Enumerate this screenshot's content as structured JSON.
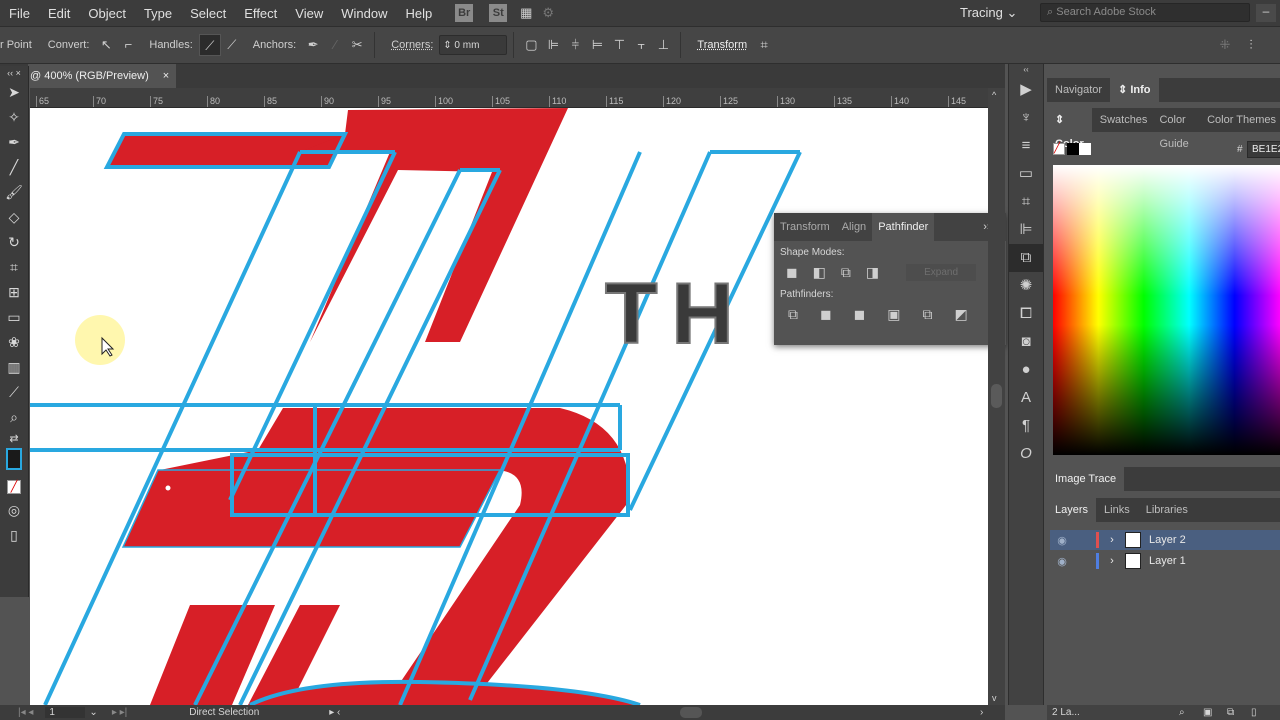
{
  "menu": [
    "File",
    "Edit",
    "Object",
    "Type",
    "Select",
    "Effect",
    "View",
    "Window",
    "Help"
  ],
  "menu_badges": {
    "bridge": "Br",
    "stock": "St"
  },
  "workspace": "Tracing",
  "search_placeholder": "Search Adobe Stock",
  "control": {
    "tool_label": "r Point",
    "convert": "Convert:",
    "handles": "Handles:",
    "anchors": "Anchors:",
    "corners": "Corners:",
    "corners_value": "0 mm",
    "transform": "Transform"
  },
  "document_tab": {
    "title": "@ 400% (RGB/Preview)",
    "close": "×"
  },
  "ruler_ticks": [
    "65",
    "70",
    "75",
    "80",
    "85",
    "90",
    "95",
    "100",
    "105",
    "110",
    "115",
    "120",
    "125",
    "130",
    "135",
    "140",
    "145"
  ],
  "artwork": {
    "text": "TH",
    "red": "#d71f27",
    "blue": "#29a8e0"
  },
  "pathfinder": {
    "tabs": [
      "Transform",
      "Align",
      "Pathfinder"
    ],
    "active": "Pathfinder",
    "shape_modes": "Shape Modes:",
    "pathfinders": "Pathfinders:",
    "expand": "Expand"
  },
  "panels": {
    "top_tabs": [
      "Navigator",
      "Info"
    ],
    "color_tabs": [
      "Color",
      "Swatches",
      "Color Guide",
      "Color Themes"
    ],
    "hex_prefix": "#",
    "hex_value": "BE1E2",
    "image_trace": "Image Trace",
    "layer_tabs": [
      "Layers",
      "Links",
      "Libraries"
    ],
    "layers": [
      {
        "name": "Layer 2",
        "color": "#e05050",
        "selected": true
      },
      {
        "name": "Layer 1",
        "color": "#4f7ee0",
        "selected": false
      }
    ],
    "layer_count": "2 La..."
  },
  "status": {
    "artboard": "1",
    "tool": "Direct Selection"
  }
}
